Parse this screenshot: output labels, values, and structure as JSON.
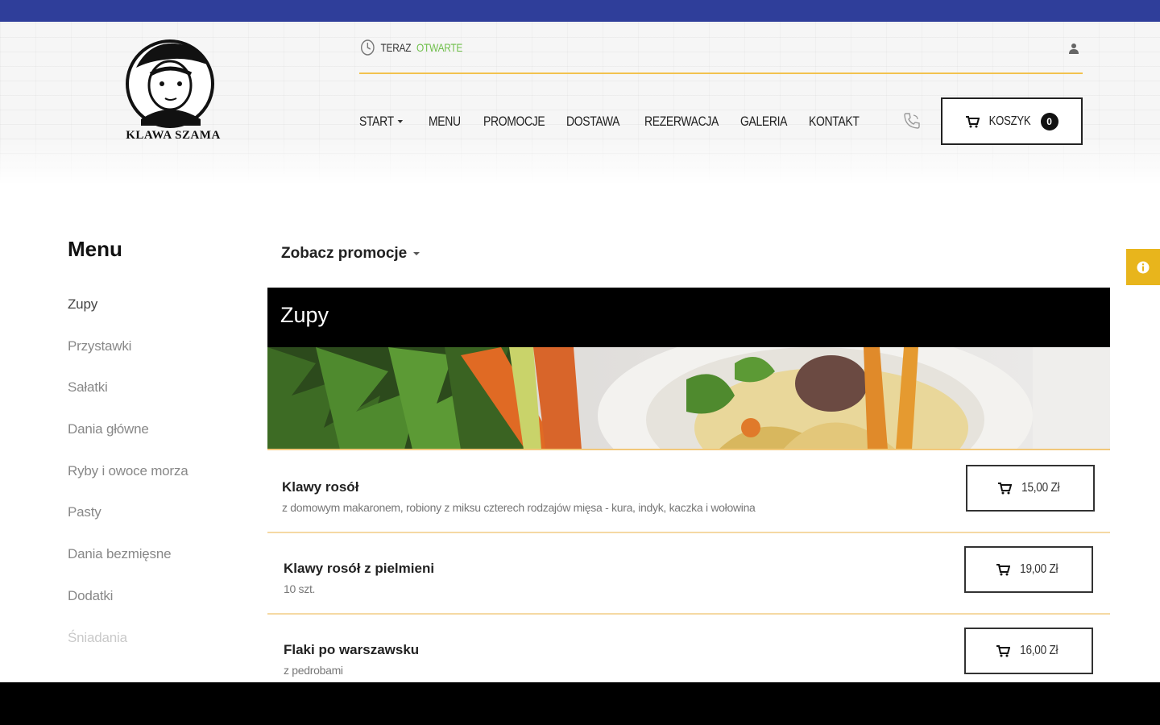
{
  "brand": {
    "name": "KLAWA SZAMA"
  },
  "status": {
    "label": "TERAZ",
    "state": "OTWARTE",
    "state_color": "#6fbf4a"
  },
  "nav": {
    "items": [
      {
        "label": "START",
        "has_dropdown": true
      },
      {
        "label": "MENU"
      },
      {
        "label": "PROMOCJE"
      },
      {
        "label": "DOSTAWA"
      },
      {
        "label": "REZERWACJA"
      },
      {
        "label": "GALERIA"
      },
      {
        "label": "KONTAKT"
      }
    ]
  },
  "cart": {
    "label": "KOSZYK",
    "count": "0"
  },
  "sidebar": {
    "title": "Menu",
    "items": [
      {
        "label": "Zupy"
      },
      {
        "label": "Przystawki"
      },
      {
        "label": "Sałatki"
      },
      {
        "label": "Dania główne"
      },
      {
        "label": "Ryby i owoce morza"
      },
      {
        "label": "Pasty"
      },
      {
        "label": "Dania bezmięsne"
      },
      {
        "label": "Dodatki"
      },
      {
        "label": "Śniadania"
      }
    ]
  },
  "promo_dropdown": {
    "label": "Zobacz promocje"
  },
  "category": {
    "title": "Zupy",
    "items": [
      {
        "name": "Klawy rosół",
        "description": "z domowym makaronem, robiony z miksu czterech rodzajów mięsa - kura, indyk, kaczka i wołowina",
        "price": "15,00 Zł"
      },
      {
        "name": "Klawy rosół z pielmieni",
        "description": "10 szt.",
        "price": "19,00 Zł"
      },
      {
        "name": "Flaki po warszawsku",
        "description": "z pedrobami",
        "price": "16,00 Zł"
      }
    ]
  },
  "colors": {
    "top_strip": "#2f3e9a",
    "accent_yellow": "#f2c24e",
    "info_tab": "#e8b51c"
  },
  "icons": {
    "clock": "clock-icon",
    "user": "user-icon",
    "phone": "phone-icon",
    "cart": "cart-icon",
    "info": "info-icon"
  }
}
